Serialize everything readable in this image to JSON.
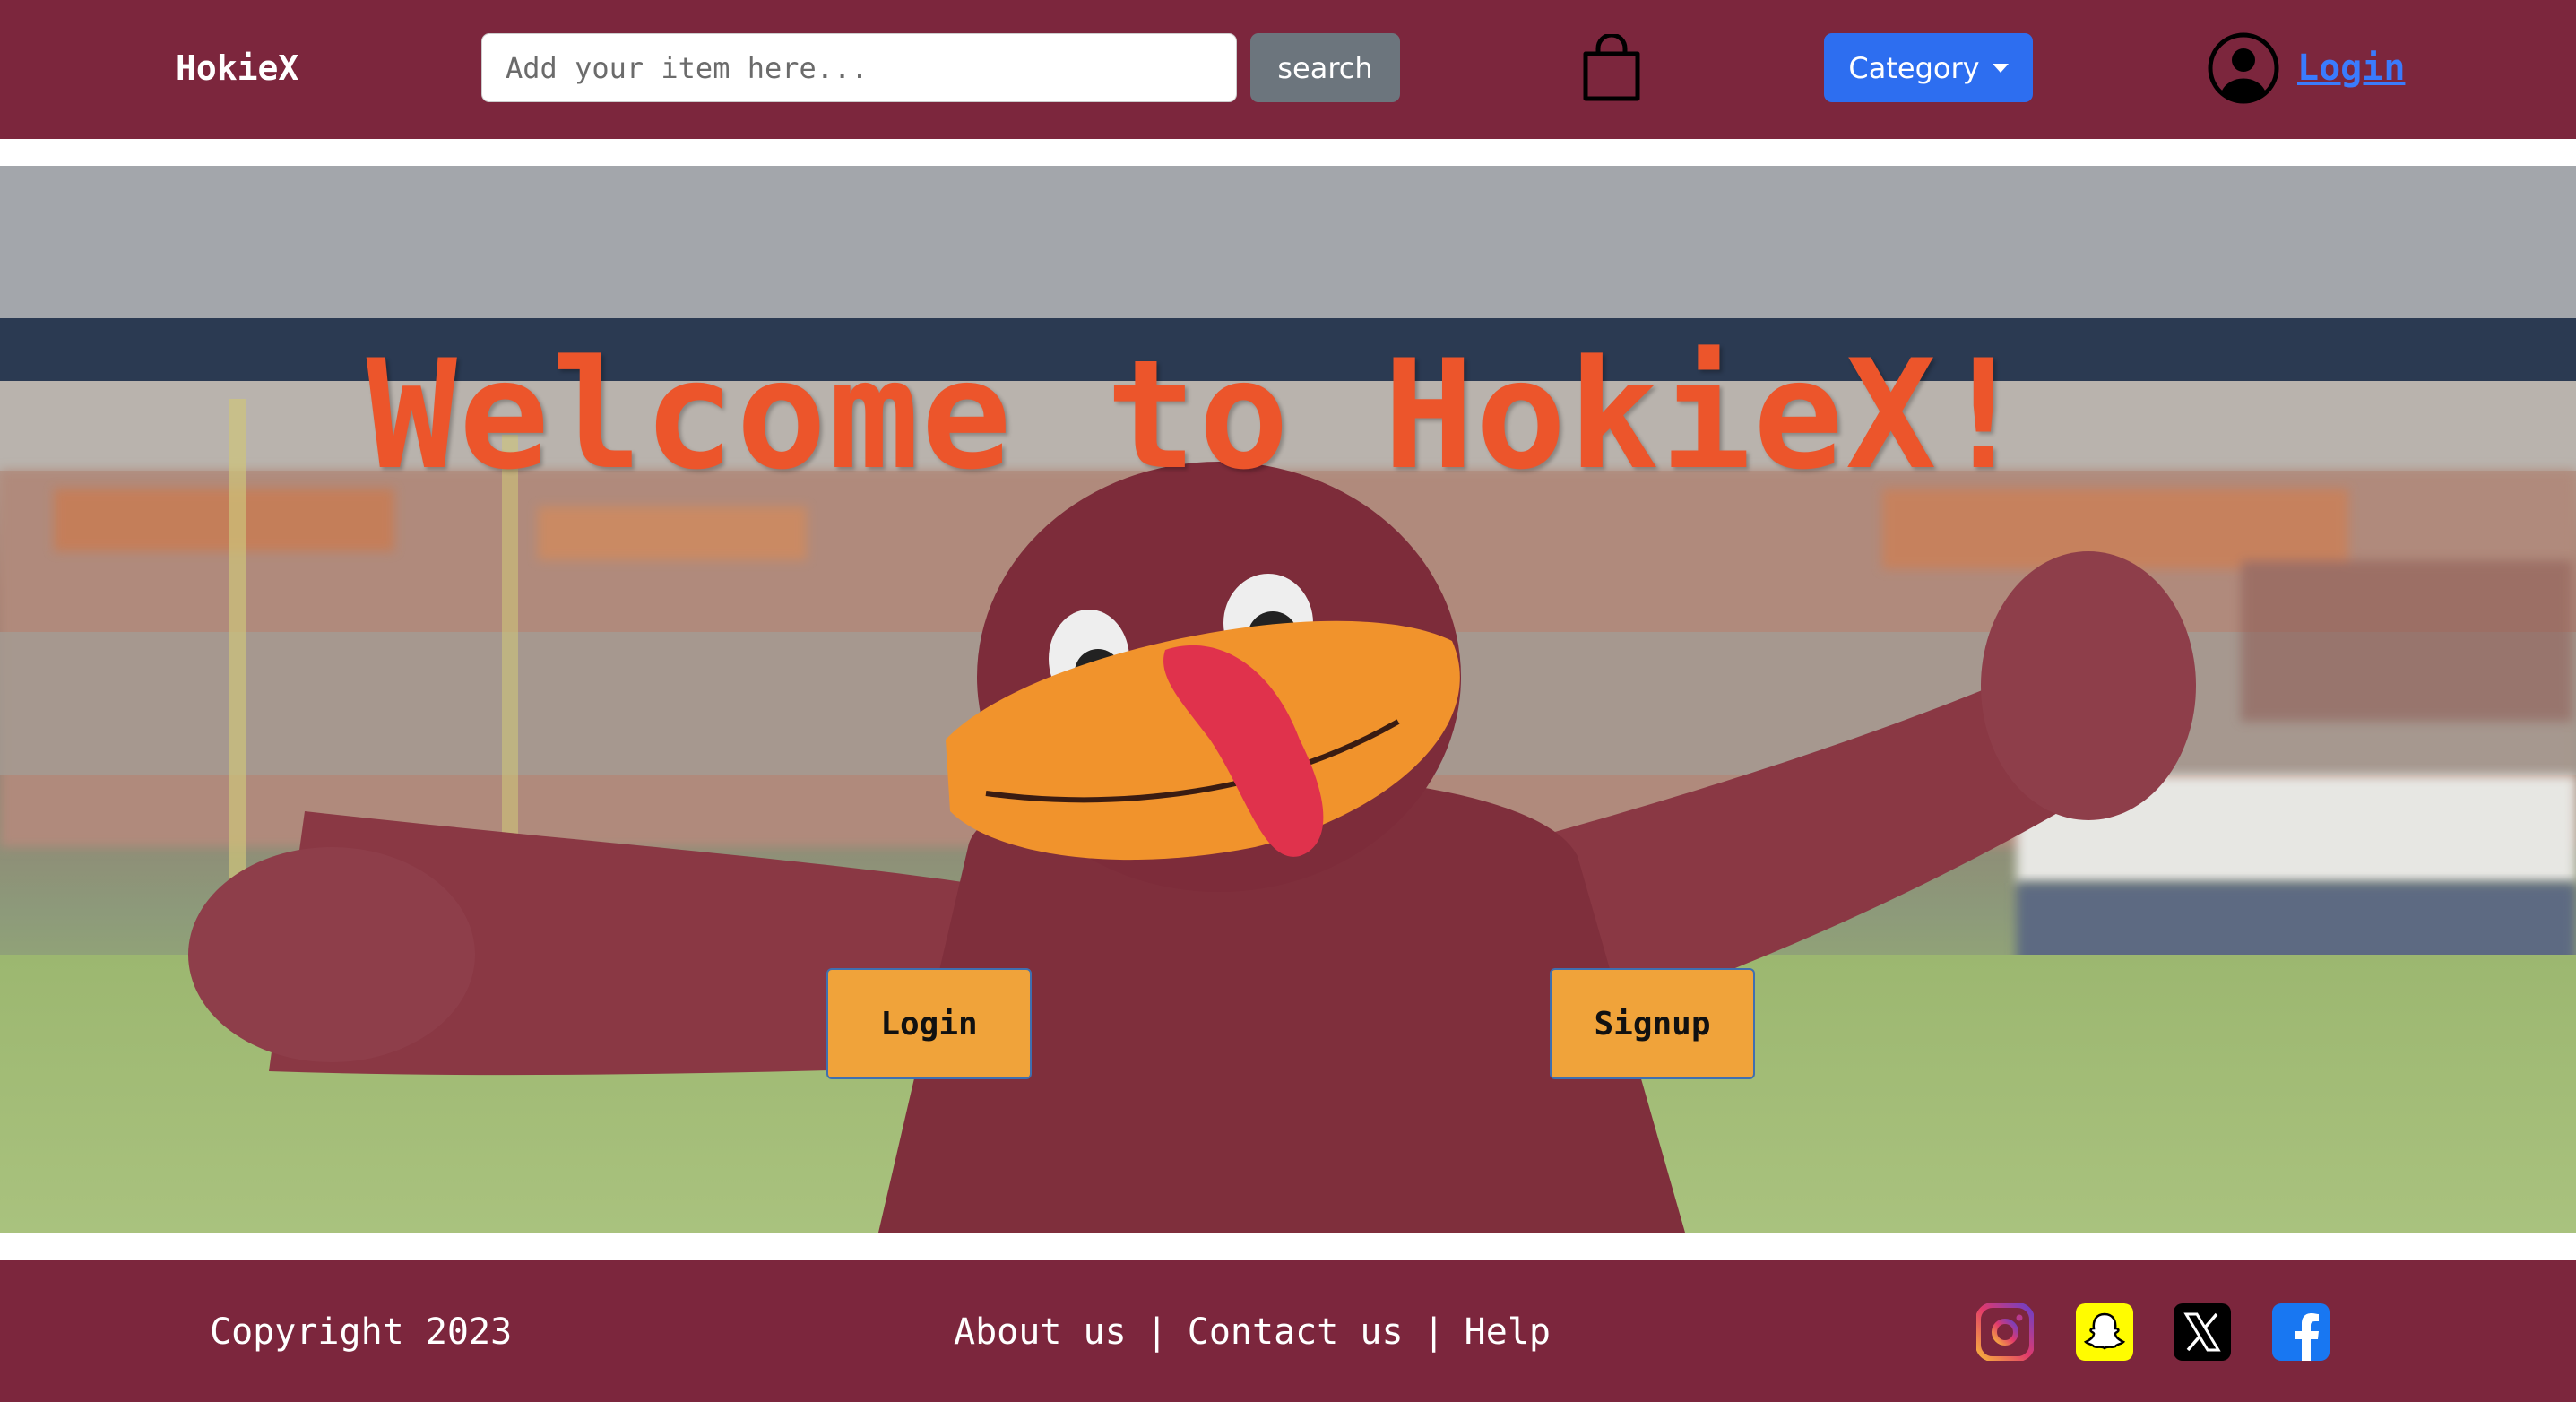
{
  "navbar": {
    "brand": "HokieX",
    "search_placeholder": "Add your item here...",
    "search_label": "search",
    "category_label": "Category",
    "login_label": "Login"
  },
  "hero": {
    "title": "Welcome to HokieX!",
    "login_label": "Login",
    "signup_label": "Signup"
  },
  "footer": {
    "copyright": "Copyright 2023",
    "links": [
      "About us",
      "Contact us",
      "Help"
    ],
    "separator": "|",
    "social_icons": [
      "instagram-icon",
      "snapchat-icon",
      "x-icon",
      "facebook-icon"
    ]
  },
  "colors": {
    "navbar_bg": "#7c263d",
    "search_btn": "#6c757d",
    "category_btn": "#2d6ef0",
    "login_link": "#3a7bfd",
    "hero_title": "#ec552b",
    "hero_btn": "#f0a33a"
  }
}
